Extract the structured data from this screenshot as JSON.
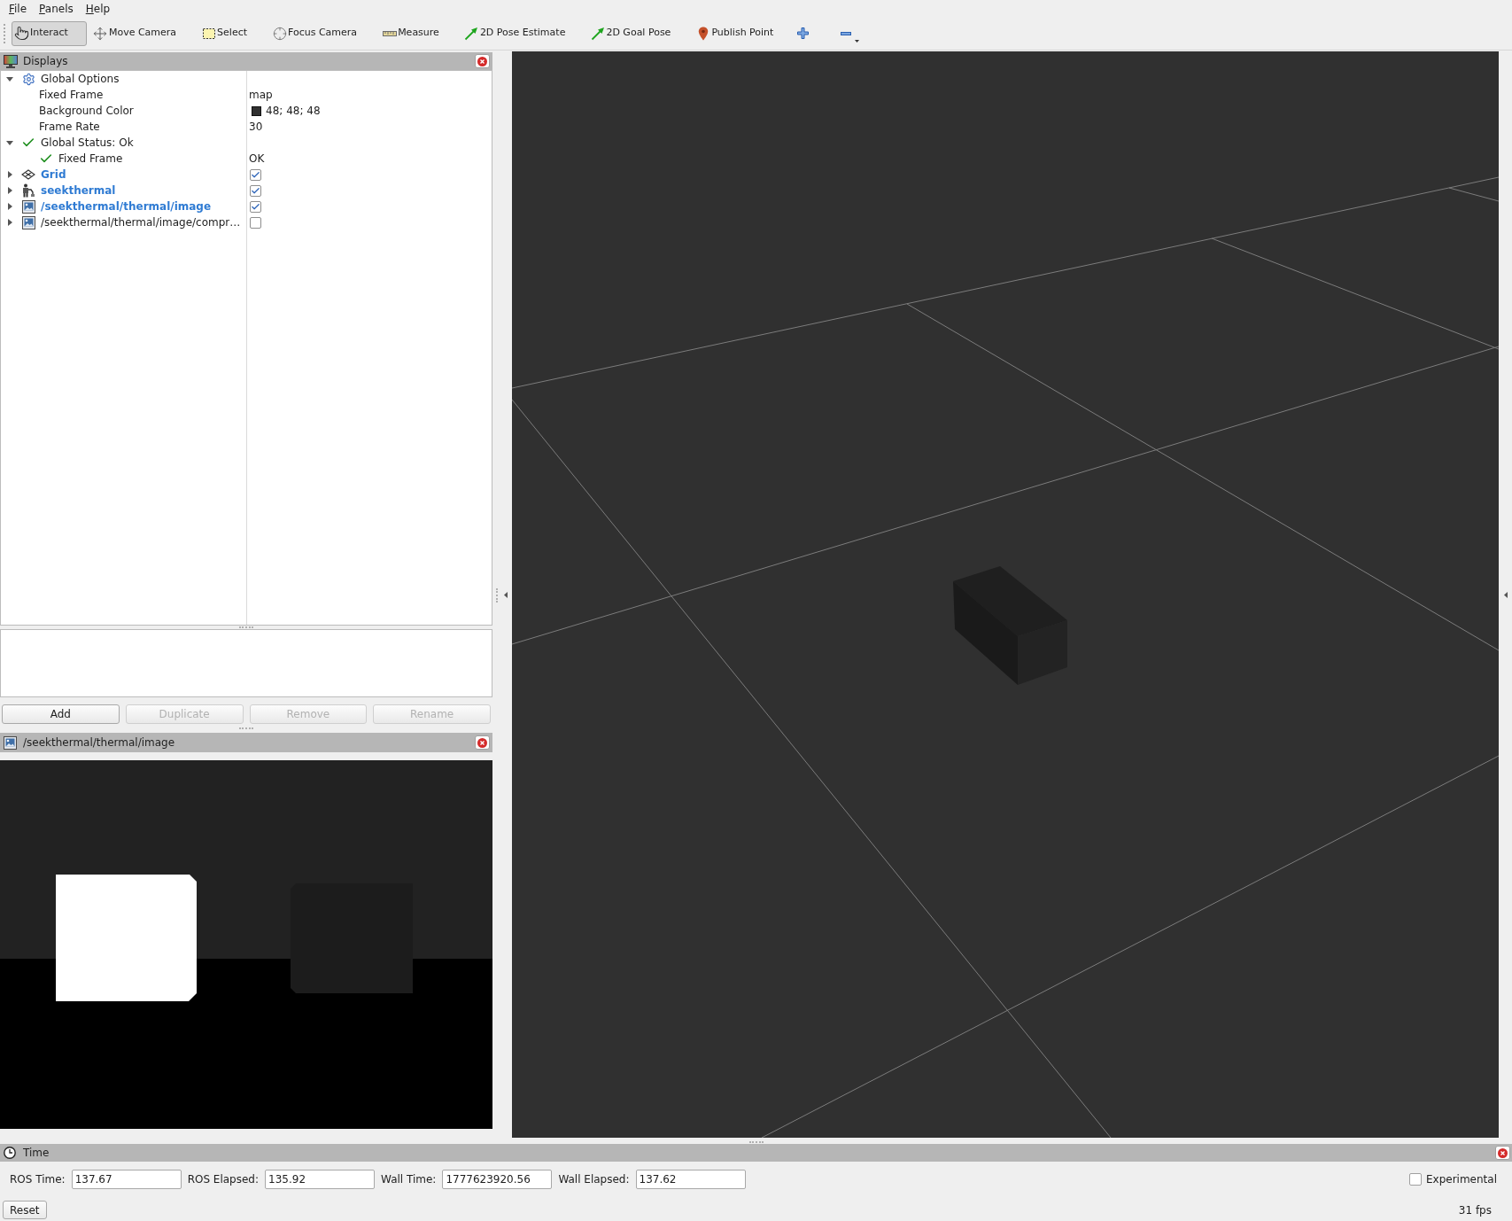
{
  "menu_bar": [
    "File",
    "Panels",
    "Help"
  ],
  "toolbar": [
    {
      "label": "Interact",
      "selected": true
    },
    {
      "label": "Move Camera",
      "selected": false
    },
    {
      "label": "Select",
      "selected": false
    },
    {
      "label": "Focus Camera",
      "selected": false
    },
    {
      "label": "Measure",
      "selected": false
    },
    {
      "label": "2D Pose Estimate",
      "selected": false
    },
    {
      "label": "2D Goal Pose",
      "selected": false
    },
    {
      "label": "Publish Point",
      "selected": false
    }
  ],
  "displays_panel": {
    "title": "Displays",
    "tree": [
      {
        "label": "Global Options",
        "kind": "options",
        "expanded": true,
        "children": [
          {
            "label": "Fixed Frame",
            "kind": "property",
            "value": "map"
          },
          {
            "label": "Background Color",
            "kind": "color",
            "value": "48; 48; 48",
            "color": "#303030"
          },
          {
            "label": "Frame Rate",
            "kind": "property",
            "value": "30"
          }
        ]
      },
      {
        "label": "Global Status: Ok",
        "kind": "status",
        "expanded": true,
        "children": [
          {
            "label": "Fixed Frame",
            "kind": "status",
            "value": "OK"
          }
        ]
      },
      {
        "label": "Grid",
        "kind": "grid",
        "expanded": false,
        "checked": true
      },
      {
        "label": "seekthermal",
        "kind": "robot",
        "expanded": false,
        "checked": true
      },
      {
        "label": "/seekthermal/thermal/image",
        "kind": "image",
        "expanded": false,
        "checked": true
      },
      {
        "label": "/seekthermal/thermal/image/compr…",
        "kind": "image",
        "expanded": false,
        "checked": false
      }
    ],
    "buttons": [
      {
        "label": "Add",
        "disabled": false
      },
      {
        "label": "Duplicate",
        "disabled": true
      },
      {
        "label": "Remove",
        "disabled": true
      },
      {
        "label": "Rename",
        "disabled": true
      }
    ]
  },
  "image_panel": {
    "title": "/seekthermal/thermal/image"
  },
  "time_panel": {
    "title": "Time",
    "fields": [
      {
        "label": "ROS Time:",
        "value": "137.67"
      },
      {
        "label": "ROS Elapsed:",
        "value": "135.92"
      },
      {
        "label": "Wall Time:",
        "value": "1777623920.56"
      },
      {
        "label": "Wall Elapsed:",
        "value": "137.62"
      }
    ],
    "experimental": {
      "label": "Experimental",
      "checked": false
    },
    "reset_button": "Reset",
    "fps": "31 fps"
  }
}
